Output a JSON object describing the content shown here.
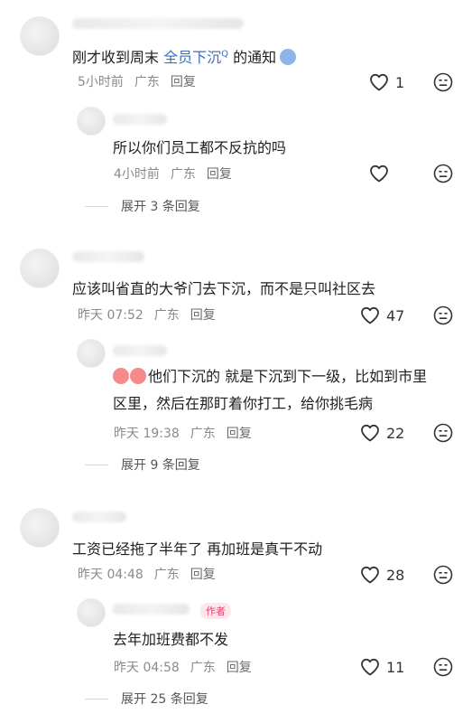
{
  "comments": [
    {
      "text_prefix": "刚才收到周末 ",
      "text_link": "全员下沉",
      "text_suffix": " 的通知",
      "link_marker": "Q",
      "time": "5小时前",
      "location": "广东",
      "reply": "回复",
      "likes": "1",
      "replies": [
        {
          "text": "所以你们员工都不反抗的吗",
          "time": "4小时前",
          "location": "广东",
          "reply": "回复",
          "likes": ""
        }
      ],
      "expand": "展开 3 条回复"
    },
    {
      "text": "应该叫省直的大爷门去下沉，而不是只叫社区去",
      "time": "昨天 07:52",
      "location": "广东",
      "reply": "回复",
      "likes": "47",
      "replies": [
        {
          "text": "他们下沉的 就是下沉到下一级，比如到市里 区里，然后在那盯着你打工，给你挑毛病",
          "time": "昨天 19:38",
          "location": "广东",
          "reply": "回复",
          "likes": "22"
        }
      ],
      "expand": "展开 9 条回复"
    },
    {
      "text": "工资已经拖了半年了 再加班是真干不动",
      "time": "昨天 04:48",
      "location": "广东",
      "reply": "回复",
      "likes": "28",
      "replies": [
        {
          "text": "去年加班费都不发",
          "time": "昨天 04:58",
          "location": "广东",
          "reply": "回复",
          "likes": "11",
          "badge": "作者"
        }
      ],
      "expand": "展开 25 条回复"
    }
  ],
  "colors": {
    "link": "#3b6fc9",
    "meta": "#8a8a8a",
    "badge": "#e8466f"
  },
  "icons": {
    "like": "heart-outline-icon",
    "dislike": "meh-face-icon"
  }
}
